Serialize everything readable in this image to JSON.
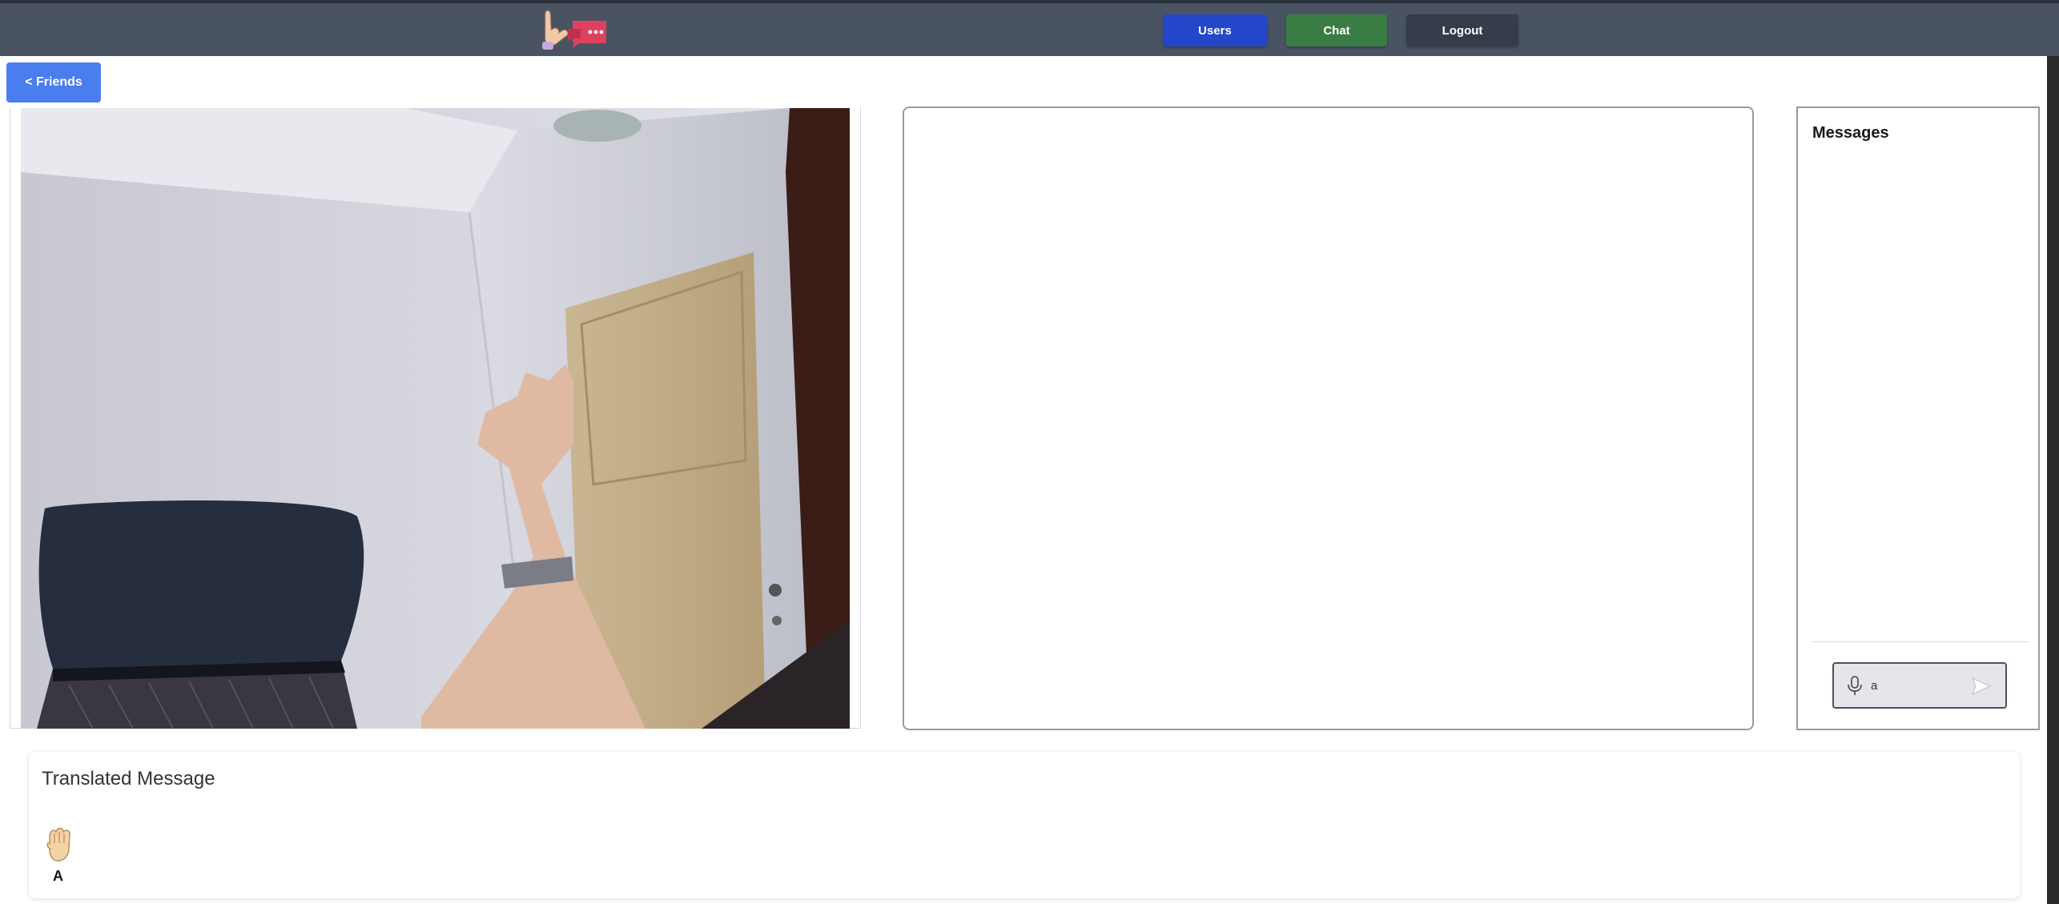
{
  "header": {
    "logo_icon": "sign-language-chat-logo-icon",
    "nav": {
      "users_label": "Users",
      "chat_label": "Chat",
      "logout_label": "Logout"
    }
  },
  "friends_button": {
    "label": "< Friends"
  },
  "messages": {
    "title": "Messages",
    "input_value": "a",
    "mic_icon": "microphone-icon",
    "send_icon": "send-icon"
  },
  "translated": {
    "title": "Translated Message",
    "signs": [
      {
        "icon": "asl-fist-a-icon",
        "letter": "A"
      }
    ]
  },
  "colors": {
    "topbar": "#4a5362",
    "users_btn": "#2446c9",
    "chat_btn": "#3a7d44",
    "logout_btn": "#353c4a",
    "friends_btn": "#4a7ded"
  }
}
